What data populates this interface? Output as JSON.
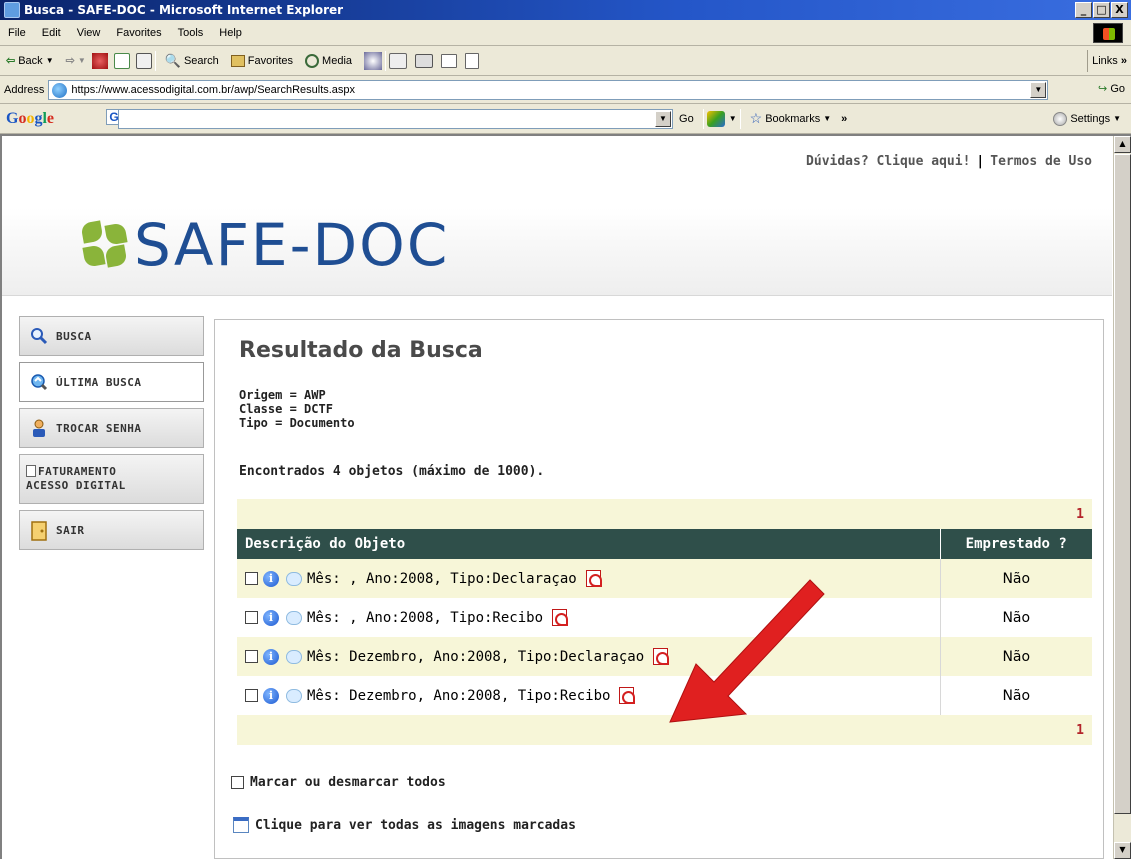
{
  "window": {
    "title": "Busca - SAFE-DOC - Microsoft Internet Explorer",
    "controls": [
      "_",
      "□",
      "X"
    ]
  },
  "menubar": {
    "items": [
      "File",
      "Edit",
      "View",
      "Favorites",
      "Tools",
      "Help"
    ]
  },
  "toolbar": {
    "back": "Back",
    "search": "Search",
    "favorites": "Favorites",
    "media": "Media",
    "links": "Links"
  },
  "addressbar": {
    "label": "Address",
    "url": "https://www.acessodigital.com.br/awp/SearchResults.aspx",
    "go": "Go"
  },
  "googlebar": {
    "logo": [
      "G",
      "o",
      "o",
      "g",
      "l",
      "e"
    ],
    "go": "Go",
    "bookmarks": "Bookmarks",
    "settings": "Settings"
  },
  "header": {
    "logo_text": "SAFE-DOC",
    "help_link": "Dúvidas? Clique aqui!",
    "separator": "|",
    "terms_link": "Termos de Uso"
  },
  "nav": {
    "items": [
      {
        "label": "BUSCA",
        "icon": "magnifier-icon"
      },
      {
        "label": "ÚLTIMA BUSCA",
        "icon": "search-history-icon"
      },
      {
        "label": "TROCAR SENHA",
        "icon": "user-key-icon"
      },
      {
        "label_line1": "FATURAMENTO",
        "label_line2": "ACESSO DIGITAL",
        "icon": "page-icon"
      },
      {
        "label": "SAIR",
        "icon": "exit-door-icon"
      }
    ]
  },
  "content": {
    "title": "Resultado da Busca",
    "criteria": [
      "Origem = AWP",
      "Classe = DCTF",
      "Tipo = Documento"
    ],
    "found_text": "Encontrados 4 objetos (máximo de 1000).",
    "pager_top": "1",
    "pager_bottom": "1",
    "columns": [
      "Descrição do Objeto",
      "Emprestado ?"
    ],
    "rows": [
      {
        "description": "Mês: , Ano:2008, Tipo:Declaraçao",
        "lent": "Não"
      },
      {
        "description": "Mês: , Ano:2008, Tipo:Recibo",
        "lent": "Não"
      },
      {
        "description": "Mês: Dezembro, Ano:2008, Tipo:Declaraçao",
        "lent": "Não"
      },
      {
        "description": "Mês: Dezembro, Ano:2008, Tipo:Recibo",
        "lent": "Não"
      }
    ],
    "toggle_all": "Marcar ou desmarcar todos",
    "view_all": "Clique para ver todas as imagens marcadas"
  },
  "colors": {
    "table_header": "#2f4f4a",
    "row_highlight": "#f7f6d8",
    "pager": "#b3242a",
    "logo": "#1f4e93",
    "logo_mark": "#8ab43a",
    "annotation_arrow": "#e02020"
  }
}
